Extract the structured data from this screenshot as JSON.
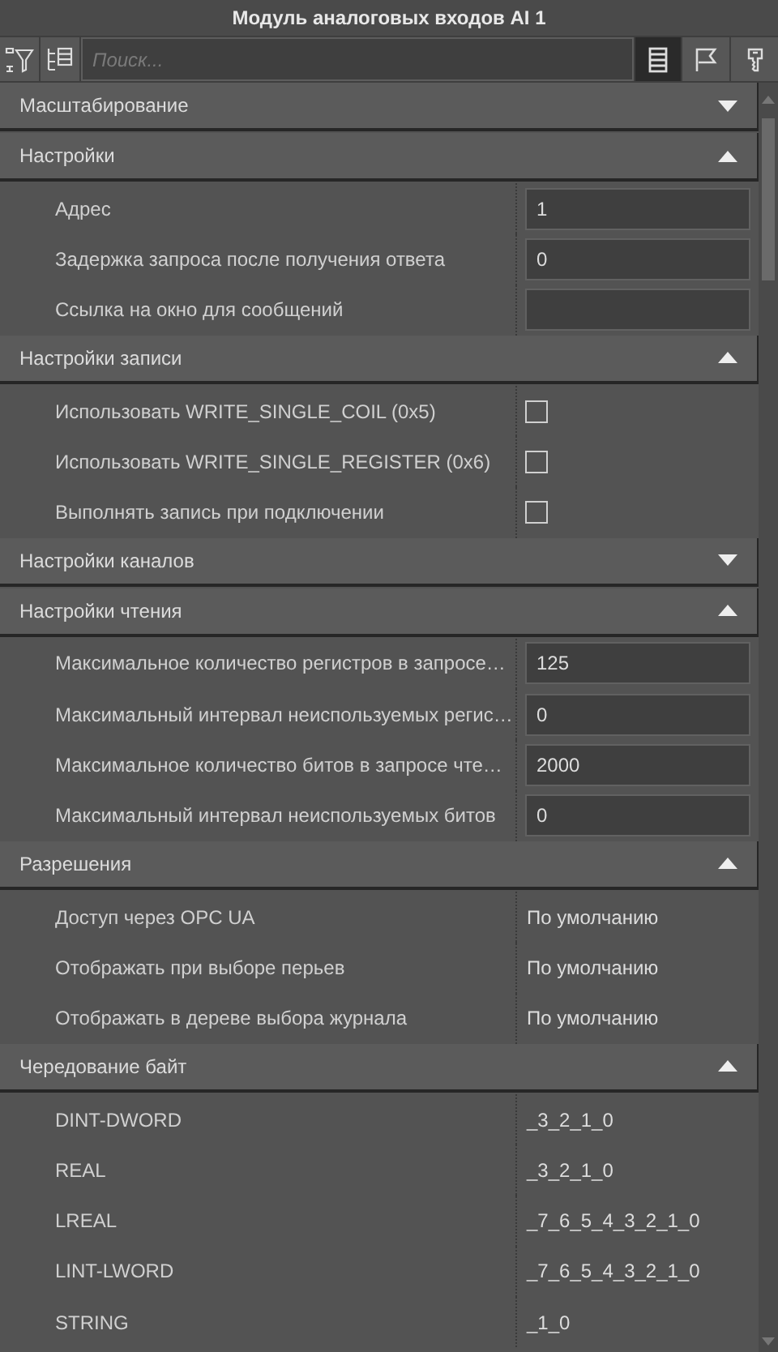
{
  "window": {
    "title": "Модуль аналоговых входов AI 1"
  },
  "toolbar": {
    "search": {
      "placeholder": "Поиск..."
    },
    "view_buttons": [
      {
        "kind": "list",
        "selected": true
      },
      {
        "kind": "flag",
        "selected": false
      },
      {
        "kind": "key",
        "selected": false
      }
    ]
  },
  "sections": [
    {
      "title": "Масштабирование",
      "expanded": false
    },
    {
      "title": "Настройки",
      "expanded": true,
      "rows": [
        {
          "kind": "field",
          "label": "Адрес",
          "value": "1"
        },
        {
          "kind": "field",
          "label": "Задержка запроса после получения ответа",
          "value": "0"
        },
        {
          "kind": "field",
          "label": "Ссылка на окно для сообщений"
        }
      ]
    },
    {
      "title": "Настройки записи",
      "expanded": true,
      "rows": [
        {
          "kind": "checkbox",
          "label": "Использовать WRITE_SINGLE_COIL (0x5)",
          "checked": false
        },
        {
          "kind": "checkbox",
          "label": "Использовать WRITE_SINGLE_REGISTER (0x6)",
          "checked": false
        },
        {
          "kind": "checkbox",
          "label": "Выполнять запись при подключении",
          "checked": false
        }
      ]
    },
    {
      "title": "Настройки каналов",
      "expanded": false
    },
    {
      "title": "Настройки чтения",
      "expanded": true,
      "rows": [
        {
          "kind": "field",
          "label": "Максимальное количество регистров в запросе…",
          "value": "125"
        },
        {
          "kind": "field",
          "label": "Максимальный интервал неиспользуемых регис…",
          "value": "0"
        },
        {
          "kind": "field",
          "label": "Максимальное количество битов в запросе чте…",
          "value": "2000"
        },
        {
          "kind": "field",
          "label": "Максимальный интервал неиспользуемых битов",
          "value": "0"
        }
      ]
    },
    {
      "title": "Разрешения",
      "expanded": true,
      "rows": [
        {
          "kind": "text",
          "label": "Доступ через OPC UA",
          "value": "По умолчанию"
        },
        {
          "kind": "text",
          "label": "Отображать при выборе перьев",
          "value": "По умолчанию"
        },
        {
          "kind": "text",
          "label": "Отображать в дереве выбора журнала",
          "value": "По умолчанию"
        }
      ]
    },
    {
      "title": "Чередование байт",
      "expanded": true,
      "rows": [
        {
          "kind": "text",
          "label": "DINT-DWORD",
          "value": "_3_2_1_0"
        },
        {
          "kind": "text",
          "label": "REAL",
          "value": "_3_2_1_0"
        },
        {
          "kind": "text",
          "label": "LREAL",
          "value": "_7_6_5_4_3_2_1_0"
        },
        {
          "kind": "text",
          "label": "LINT-LWORD",
          "value": "_7_6_5_4_3_2_1_0"
        },
        {
          "kind": "text",
          "label": "STRING",
          "value": "_1_0"
        }
      ]
    }
  ]
}
